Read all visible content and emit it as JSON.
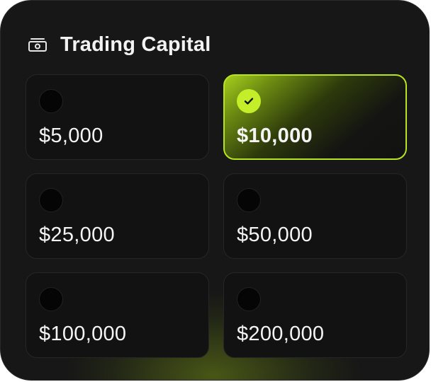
{
  "header": {
    "title": "Trading Capital",
    "icon": "cash-icon"
  },
  "options": [
    {
      "label": "$5,000",
      "selected": false
    },
    {
      "label": "$10,000",
      "selected": true
    },
    {
      "label": "$25,000",
      "selected": false
    },
    {
      "label": "$50,000",
      "selected": false
    },
    {
      "label": "$100,000",
      "selected": false
    },
    {
      "label": "$200,000",
      "selected": false
    }
  ],
  "colors": {
    "accent": "#b6e51f",
    "card_background": "#171717",
    "option_background": "#121212",
    "text": "#f4f4f4"
  }
}
